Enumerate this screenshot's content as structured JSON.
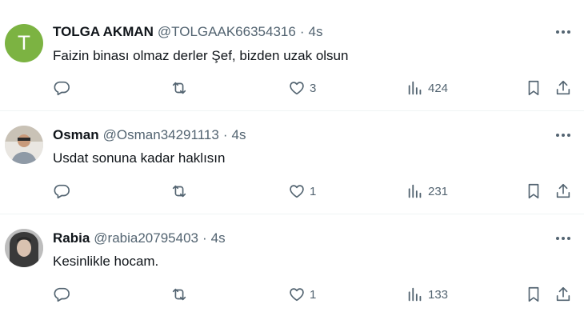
{
  "tweets": [
    {
      "avatar_letter": "T",
      "avatar_color": "#7cb342",
      "name": "TOLGA AKMAN",
      "handle": "@TOLGAAK66354316",
      "dot": "·",
      "time": "4s",
      "text": "Faizin binası olmaz derler Şef, bizden uzak olsun",
      "likes": "3",
      "views": "424"
    },
    {
      "name": "Osman",
      "handle": "@Osman34291113",
      "dot": "·",
      "time": "4s",
      "text": "Usdat sonuna kadar haklısın",
      "likes": "1",
      "views": "231"
    },
    {
      "name": "Rabia",
      "handle": "@rabia20795403",
      "dot": "·",
      "time": "4s",
      "text": "Kesinlikle hocam.",
      "likes": "1",
      "views": "133"
    }
  ],
  "icons": {
    "reply": "speech-bubble-icon",
    "retweet": "retweet-icon",
    "like": "heart-icon",
    "views": "bar-chart-icon",
    "bookmark": "bookmark-icon",
    "share": "share-icon",
    "more": "more-dots-icon"
  },
  "colors": {
    "icon_gray": "#536471",
    "text": "#0f1419",
    "divider": "#eff3f4"
  }
}
